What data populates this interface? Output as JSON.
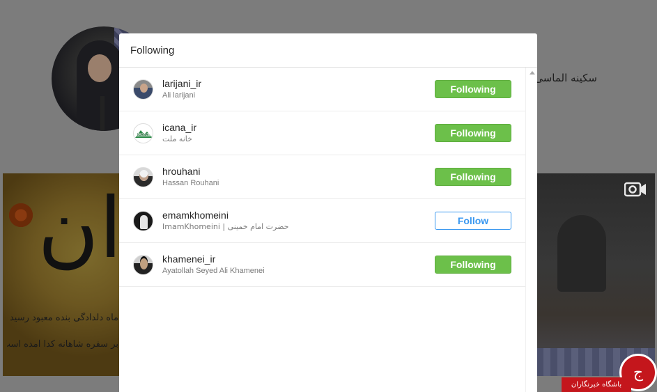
{
  "background": {
    "profile_name": "سکینه الماسی ن",
    "left_post_verse_lines": [
      "ماه دلدادگی بنده معبود رسید",
      "بر سفره شاهانه کدا آمده است"
    ],
    "left_post_calligraphy": "ان",
    "watermark_text": "باشگاه خبرنگاران"
  },
  "modal": {
    "title": "Following",
    "accent_following": "#6cc04a",
    "accent_follow": "#3897f0",
    "accounts": [
      {
        "username": "larijani_ir",
        "full_name": "Ali larijani",
        "button": "Following",
        "avatar": "larijani-avatar"
      },
      {
        "username": "icana_ir",
        "full_name": "خانه ملت",
        "button": "Following",
        "avatar": "icana-avatar"
      },
      {
        "username": "hrouhani",
        "full_name": "Hassan Rouhani",
        "button": "Following",
        "avatar": "hrouhani-avatar"
      },
      {
        "username": "emamkhomeini",
        "full_name": "حضرت امام خمینی | ImamKhomeini",
        "button": "Follow",
        "avatar": "emamkhomeini-avatar"
      },
      {
        "username": "khamenei_ir",
        "full_name": "Ayatollah Seyed Ali Khamenei",
        "button": "Following",
        "avatar": "khamenei-avatar"
      }
    ]
  }
}
